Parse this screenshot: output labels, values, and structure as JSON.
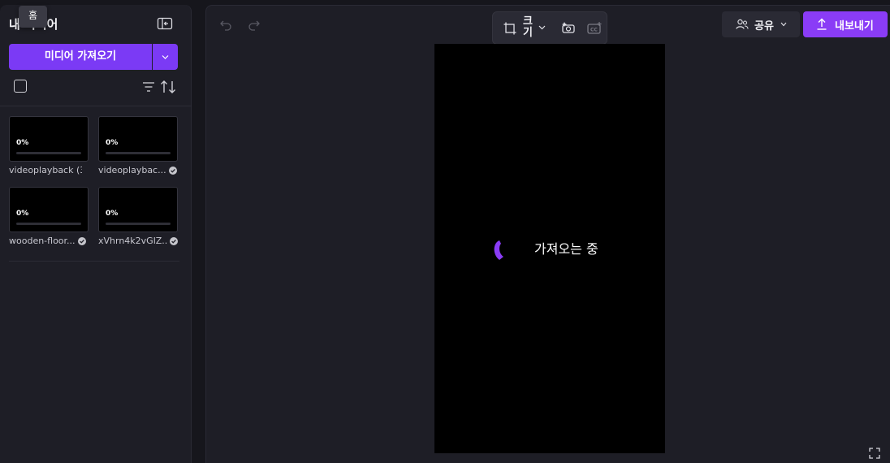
{
  "media_panel": {
    "title": "내 미디어",
    "tooltip": "홈",
    "import_label": "미디어 가져오기",
    "items": [
      {
        "name": "videoplayback (3...",
        "progress_label": "0%",
        "progress": 0,
        "verified": false
      },
      {
        "name": "videoplaybac...",
        "progress_label": "0%",
        "progress": 0,
        "verified": true
      },
      {
        "name": "wooden-floor...",
        "progress_label": "0%",
        "progress": 0,
        "verified": true
      },
      {
        "name": "xVhrn4k2vGlZ...",
        "progress_label": "0%",
        "progress": 0,
        "verified": true
      }
    ]
  },
  "toolbar": {
    "size_label": "크기",
    "icons": [
      "resize-icon",
      "chevron-down-icon",
      "background-remove-icon",
      "caption-add-icon"
    ]
  },
  "header": {
    "share_label": "공유",
    "export_label": "내보내기"
  },
  "canvas": {
    "loading_text": "가져오는 중"
  },
  "colors": {
    "accent": "#7b3af5",
    "panel_bg": "#1e1e26",
    "app_bg": "#16161c"
  }
}
